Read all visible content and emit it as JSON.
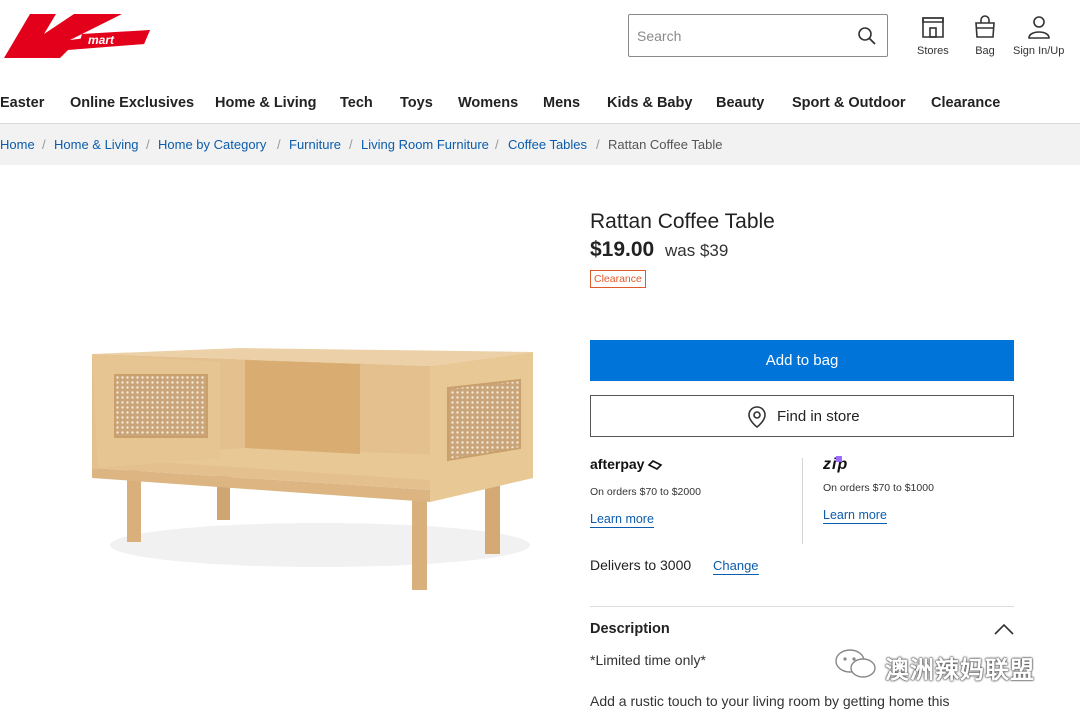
{
  "brand": {
    "logo_text": "mart",
    "logo_color": "#e3001b"
  },
  "search": {
    "placeholder": "Search",
    "value": ""
  },
  "header_actions": [
    {
      "label": "Stores",
      "icon": "store-icon"
    },
    {
      "label": "Bag",
      "icon": "bag-icon"
    },
    {
      "label": "Sign In/Up",
      "icon": "user-icon"
    }
  ],
  "nav": {
    "items": [
      "Easter",
      "Online Exclusives",
      "Home & Living",
      "Tech",
      "Toys",
      "Womens",
      "Mens",
      "Kids & Baby",
      "Beauty",
      "Sport & Outdoor",
      "Clearance"
    ]
  },
  "breadcrumb": {
    "links": [
      "Home",
      "Home & Living",
      "Home by Category",
      "Furniture",
      "Living Room Furniture",
      "Coffee Tables"
    ],
    "current": "Rattan Coffee Table"
  },
  "product": {
    "title": "Rattan Coffee Table",
    "price": "$19.00",
    "was_price": "was $39",
    "badge": "Clearance",
    "add_to_bag": "Add to bag",
    "find_in_store": "Find in store"
  },
  "payments": {
    "afterpay": {
      "name": "afterpay",
      "note": "On orders $70 to $2000",
      "link": "Learn more"
    },
    "zip": {
      "name": "zip",
      "note": "On orders $70 to $1000",
      "link": "Learn more"
    }
  },
  "delivery": {
    "text": "Delivers to 3000",
    "change": "Change"
  },
  "description": {
    "heading": "Description",
    "line1": "*Limited time only*",
    "line2": "Add a rustic touch to your living room by getting home this"
  },
  "watermark": {
    "text": "澳洲辣妈联盟"
  },
  "colors": {
    "accent": "#0074d9",
    "link": "#0b5cad",
    "badge": "#e0592a"
  }
}
